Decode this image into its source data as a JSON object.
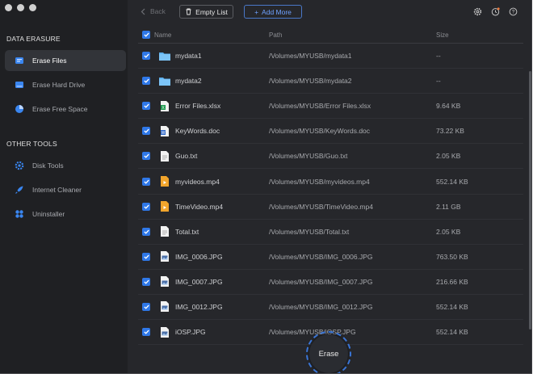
{
  "sidebar": {
    "sections": [
      {
        "title": "DATA ERASURE",
        "items": [
          {
            "label": "Erase Files",
            "icon": "erase-files-icon",
            "active": true
          },
          {
            "label": "Erase Hard Drive",
            "icon": "hard-drive-icon",
            "active": false
          },
          {
            "label": "Erase Free Space",
            "icon": "pie-chart-icon",
            "active": false
          }
        ]
      },
      {
        "title": "OTHER TOOLS",
        "items": [
          {
            "label": "Disk Tools",
            "icon": "gear-icon",
            "active": false
          },
          {
            "label": "Internet Cleaner",
            "icon": "rocket-icon",
            "active": false
          },
          {
            "label": "Uninstaller",
            "icon": "apps-grid-icon",
            "active": false
          }
        ]
      }
    ]
  },
  "toolbar": {
    "back_label": "Back",
    "empty_list_label": "Empty List",
    "add_more_label": "Add More"
  },
  "table": {
    "headers": {
      "name": "Name",
      "path": "Path",
      "size": "Size"
    },
    "rows": [
      {
        "name": "mydata1",
        "path": "/Volumes/MYUSB/mydata1",
        "size": "--",
        "type": "folder"
      },
      {
        "name": "mydata2",
        "path": "/Volumes/MYUSB/mydata2",
        "size": "--",
        "type": "folder"
      },
      {
        "name": "Error Files.xlsx",
        "path": "/Volumes/MYUSB/Error Files.xlsx",
        "size": "9.64 KB",
        "type": "xlsx"
      },
      {
        "name": "KeyWords.doc",
        "path": "/Volumes/MYUSB/KeyWords.doc",
        "size": "73.22 KB",
        "type": "doc"
      },
      {
        "name": "Guo.txt",
        "path": "/Volumes/MYUSB/Guo.txt",
        "size": "2.05 KB",
        "type": "txt"
      },
      {
        "name": "myvideos.mp4",
        "path": "/Volumes/MYUSB/myvideos.mp4",
        "size": "552.14 KB",
        "type": "mp4"
      },
      {
        "name": "TimeVideo.mp4",
        "path": "/Volumes/MYUSB/TimeVideo.mp4",
        "size": "2.11 GB",
        "type": "mp4"
      },
      {
        "name": "Total.txt",
        "path": "/Volumes/MYUSB/Total.txt",
        "size": "2.05 KB",
        "type": "txt"
      },
      {
        "name": "IMG_0006.JPG",
        "path": "/Volumes/MYUSB/IMG_0006.JPG",
        "size": "763.50 KB",
        "type": "jpg"
      },
      {
        "name": "IMG_0007.JPG",
        "path": "/Volumes/MYUSB/IMG_0007.JPG",
        "size": "216.66 KB",
        "type": "jpg"
      },
      {
        "name": "IMG_0012.JPG",
        "path": "/Volumes/MYUSB/IMG_0012.JPG",
        "size": "552.14 KB",
        "type": "jpg"
      },
      {
        "name": "iOSP.JPG",
        "path": "/Volumes/MYUSB/iOSP.JPG",
        "size": "552.14 KB",
        "type": "jpg"
      }
    ]
  },
  "erase_label": "Erase",
  "colors": {
    "accent": "#2f78e8",
    "background": "#26272b",
    "sidebar": "#1f2023"
  }
}
